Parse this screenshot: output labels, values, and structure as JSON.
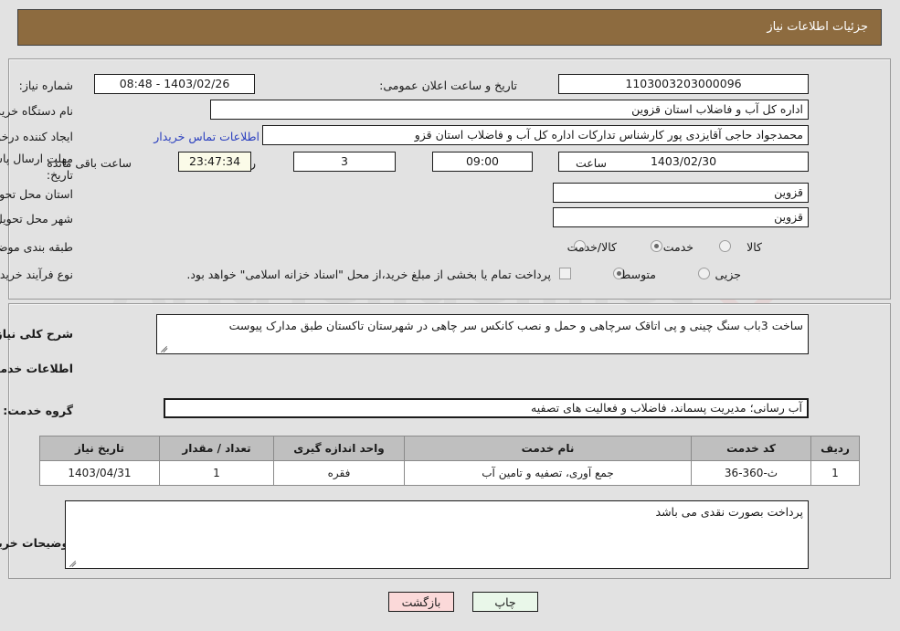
{
  "header": {
    "title": "جزئیات اطلاعات نیاز",
    "bar_color": "#8d6b3f"
  },
  "watermark": {
    "text": "AriaTender.net"
  },
  "top_panel": {
    "need_number_label": "شماره نیاز:",
    "need_number_value": "1103003203000096",
    "announce_datetime_label": "تاریخ و ساعت اعلان عمومی:",
    "announce_datetime_value": "1403/02/26 - 08:48",
    "buyer_org_label": "نام دستگاه خریدار:",
    "buyer_org_value": "اداره کل آب و فاضلاب استان قزوین",
    "requester_label": "ایجاد کننده درخواست:",
    "requester_value": "محمدجواد حاجی آقایزدی پور کارشناس تدارکات اداره کل آب و فاضلاب استان قزو",
    "contact_link": "اطلاعات تماس خریدار",
    "deadline_label_line1": "مهلت ارسال پاسخ: تا",
    "deadline_label_line2": "تاریخ:",
    "deadline_date_value": "1403/02/30",
    "hour_label": "ساعت",
    "hour_value": "09:00",
    "days_value": "3",
    "days_label": "روز و",
    "countdown_value": "23:47:34",
    "countdown_label": "ساعت باقی مانده",
    "province_label": "استان محل تحویل:",
    "province_value": "قزوین",
    "city_label": "شهر محل تحویل:",
    "city_value": "قزوین",
    "category_label": "طبقه بندی موضوعی:",
    "category_options": [
      "کالا",
      "خدمت",
      "کالا/خدمت"
    ],
    "category_selected": "خدمت",
    "process_label": "نوع فرآیند خرید :",
    "process_options": [
      "جزیی",
      "متوسط"
    ],
    "process_selected": "متوسط",
    "treasury_checkbox_checked": false,
    "treasury_note": "پرداخت تمام یا بخشی از مبلغ خرید،از محل \"اسناد خزانه اسلامی\" خواهد بود."
  },
  "mid_panel": {
    "general_desc_label": "شرح کلی نیاز:",
    "general_desc_value": "ساخت  3باب سنگ چینی و پی اتاقک سرچاهی و حمل و نصب کانکس  سر چاهی در شهرستان تاکستان طبق مدارک پیوست",
    "services_section_title": "اطلاعات خدمات مورد نیاز",
    "service_group_label": "گروه خدمت:",
    "service_group_value": "آب رسانی؛ مدیریت پسماند، فاضلاب و فعالیت های تصفیه",
    "table": {
      "headers": [
        "ردیف",
        "کد خدمت",
        "نام خدمت",
        "واحد اندازه گیری",
        "تعداد / مقدار",
        "تاریخ نیاز"
      ],
      "rows": [
        {
          "row": "1",
          "code": "ث-360-36",
          "name": "جمع آوری، تصفیه و تامین آب",
          "unit": "فقره",
          "qty": "1",
          "date": "1403/04/31"
        }
      ]
    },
    "buyer_notes_label": "توضیحات خریدار:",
    "buyer_notes_value": "پرداخت بصورت نقدی می باشد"
  },
  "footer": {
    "print_label": "چاپ",
    "back_label": "بازگشت"
  }
}
